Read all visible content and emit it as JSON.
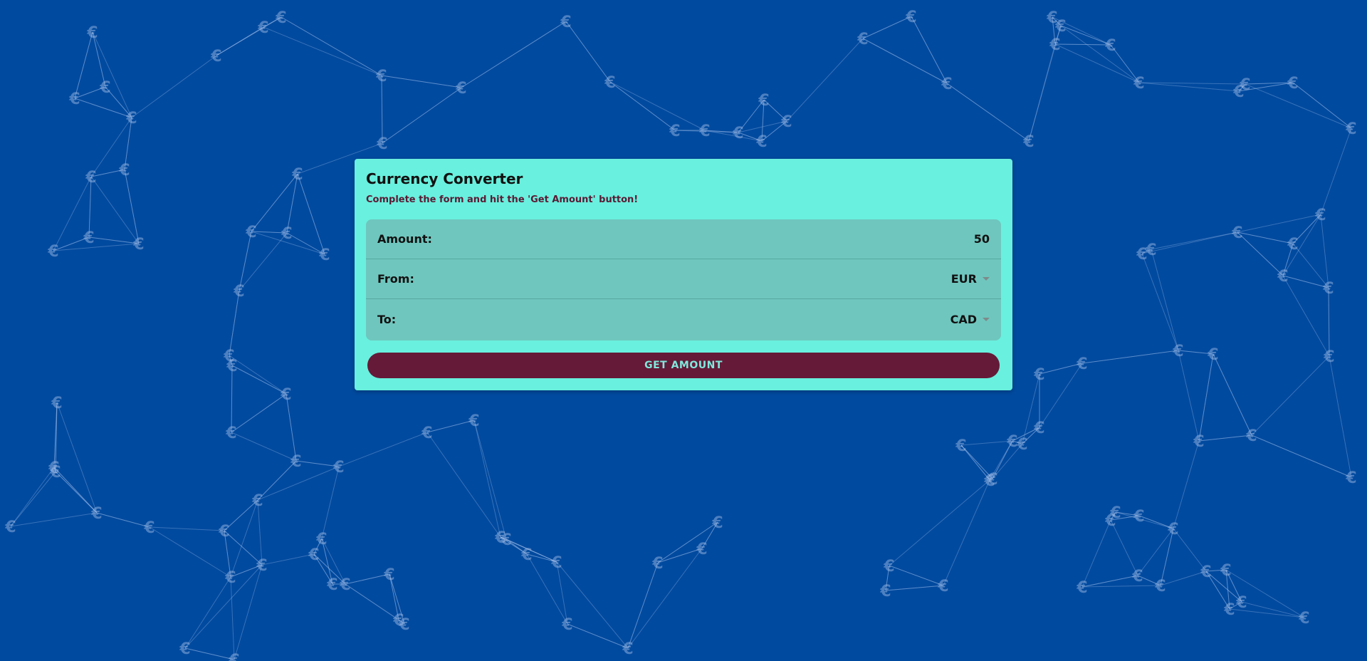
{
  "header": {
    "title": "Currency Converter",
    "subtitle": "Complete the form and hit the 'Get Amount' button!"
  },
  "form": {
    "amount_label": "Amount:",
    "amount_value": "50",
    "from_label": "From:",
    "from_value": "EUR",
    "to_label": "To:",
    "to_value": "CAD"
  },
  "actions": {
    "submit_label": "GET AMOUNT"
  },
  "background": {
    "icon_glyph": "€"
  },
  "colors": {
    "page_background": "#004a9f",
    "card_background": "#69f0de",
    "list_background": "#6fc6be",
    "button_background": "#651a38",
    "button_text": "#7fe8dc"
  }
}
